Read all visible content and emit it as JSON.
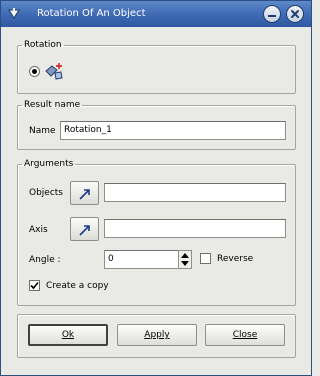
{
  "window": {
    "title": "Rotation Of An Object"
  },
  "rotation": {
    "legend": "Rotation",
    "mode_selected": true
  },
  "result": {
    "legend": "Result name",
    "name_label": "Name",
    "name_value": "Rotation_1"
  },
  "arguments": {
    "legend": "Arguments",
    "objects_label": "Objects",
    "objects_value": "",
    "axis_label": "Axis",
    "axis_value": "",
    "angle_label": "Angle :",
    "angle_value": "0",
    "reverse_label": "Reverse",
    "reverse_checked": false,
    "copy_label": "Create a copy",
    "copy_checked": true
  },
  "buttons": {
    "ok": "Ok",
    "apply": "Apply",
    "close": "Close"
  },
  "icons": {
    "app": "app-menu-icon",
    "minimize": "minimize-icon",
    "close": "close-icon",
    "rotation": "rotation-object-icon",
    "select": "select-arrow-icon"
  }
}
